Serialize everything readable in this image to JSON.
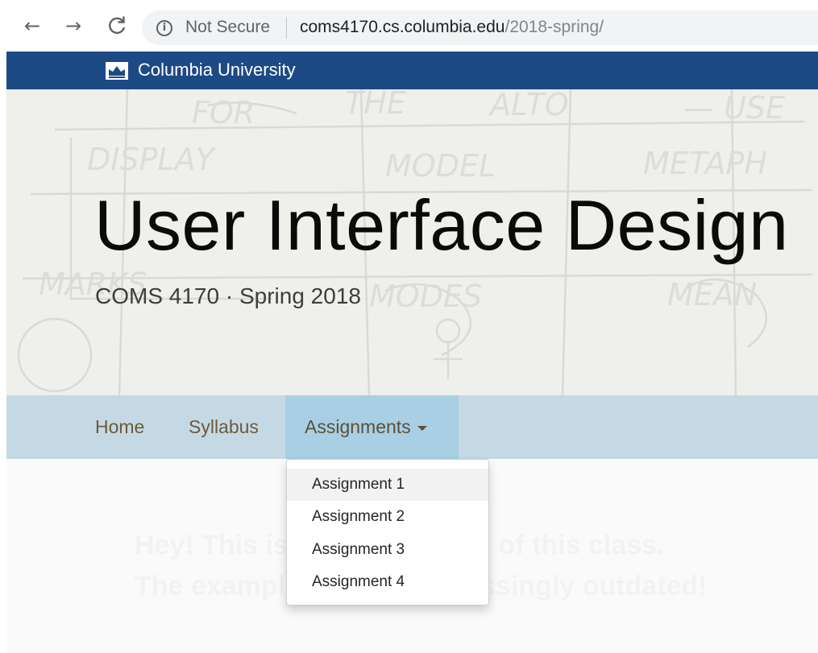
{
  "browser": {
    "back_icon": "←",
    "forward_icon": "→",
    "reload_icon": "C",
    "info_icon": "i",
    "security_label": "Not Secure",
    "url_host": "coms4170.cs.columbia.edu",
    "url_path": "/2018-spring/"
  },
  "brand_bar": {
    "name": "Columbia University",
    "color": "#1c4a85"
  },
  "hero": {
    "title": "User Interface Design",
    "subtitle": "COMS 4170 · Spring 2018"
  },
  "navbar": {
    "items": [
      {
        "label": "Home"
      },
      {
        "label": "Syllabus"
      },
      {
        "label": "Assignments"
      }
    ],
    "color": "#c5d9e4",
    "active_color": "#a8cfe3"
  },
  "dropdown": {
    "items": [
      {
        "label": "Assignment 1"
      },
      {
        "label": "Assignment 2"
      },
      {
        "label": "Assignment 3"
      },
      {
        "label": "Assignment 4"
      }
    ]
  },
  "content": {
    "line1": "Hey! This is the old version of this class.",
    "line2": "The examples are embarrassingly outdated!"
  }
}
